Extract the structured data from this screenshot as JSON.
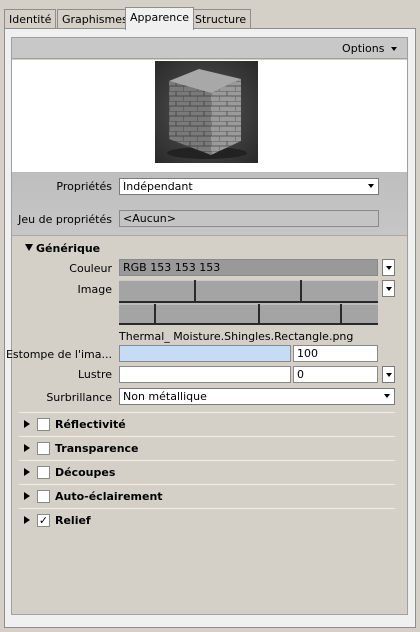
{
  "tabs": [
    {
      "label": "Identité"
    },
    {
      "label": "Graphismes"
    },
    {
      "label": "Apparence"
    },
    {
      "label": "Structure"
    }
  ],
  "options_label": "Options",
  "properties": {
    "label": "Propriétés",
    "value": "Indépendant",
    "set_label": "Jeu de propriétés",
    "set_value": "<Aucun>"
  },
  "generic": {
    "title": "Générique",
    "color_label": "Couleur",
    "color_value": "RGB 153 153 153",
    "image_label": "Image",
    "image_filename": "Thermal_ Moisture.Shingles.Rectangle.png",
    "blur_label": "Estompe de l'ima...",
    "blur_value": "100",
    "gloss_label": "Lustre",
    "gloss_value": "",
    "gloss_value2": "0",
    "highlight_label": "Surbrillance",
    "highlight_value": "Non métallique"
  },
  "sections": [
    {
      "label": "Réflectivité",
      "checked": false
    },
    {
      "label": "Transparence",
      "checked": false
    },
    {
      "label": "Découpes",
      "checked": false
    },
    {
      "label": "Auto-éclairement",
      "checked": false
    },
    {
      "label": "Relief",
      "checked": true
    }
  ],
  "check_mark": "✓",
  "colors": {
    "swatch": "#999999",
    "blur_field": "#c6dcf4"
  }
}
